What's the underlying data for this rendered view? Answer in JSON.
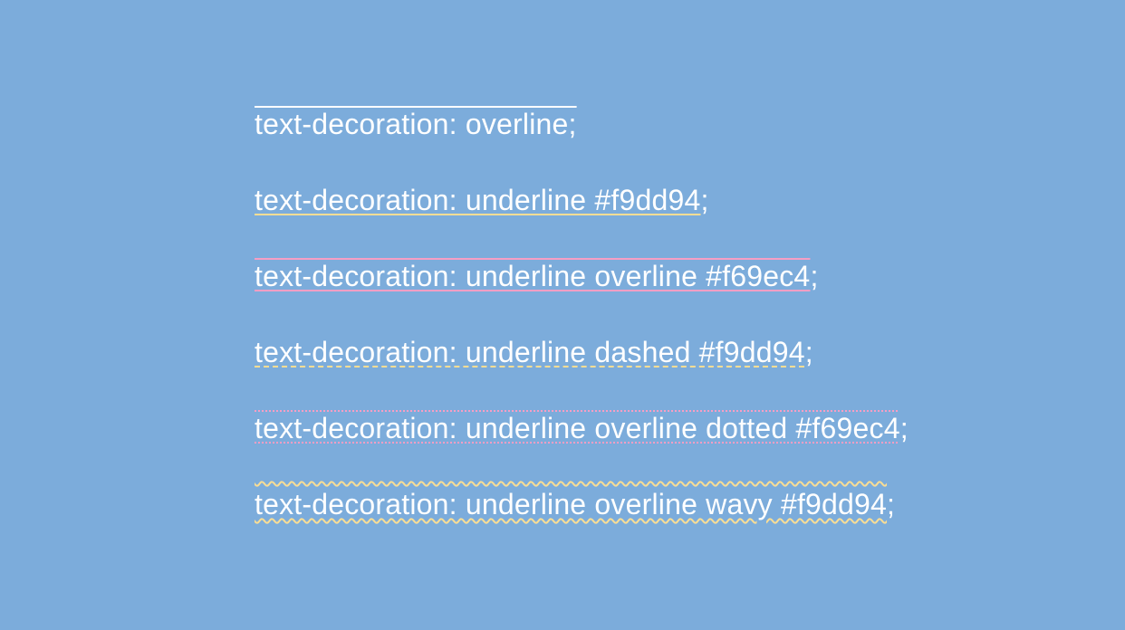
{
  "lines": {
    "l1": {
      "text": "text-decoration: overline;"
    },
    "l2": {
      "text": "text-decoration: underline #f9dd94",
      "trail": ";"
    },
    "l3": {
      "text": "text-decoration: underline overline #f69ec4",
      "trail": ";"
    },
    "l4": {
      "text": "text-decoration: underline dashed #f9dd94",
      "trail": ";"
    },
    "l5": {
      "text": "text-decoration: underline overline dotted #f69ec4",
      "trail": ";"
    },
    "l6": {
      "text": "text-decoration: underline overline wavy #f9dd94",
      "trail": ";"
    }
  },
  "colors": {
    "background": "#7cacdb",
    "text": "#ffffff",
    "yellow": "#f9dd94",
    "pink": "#f69ec4"
  }
}
